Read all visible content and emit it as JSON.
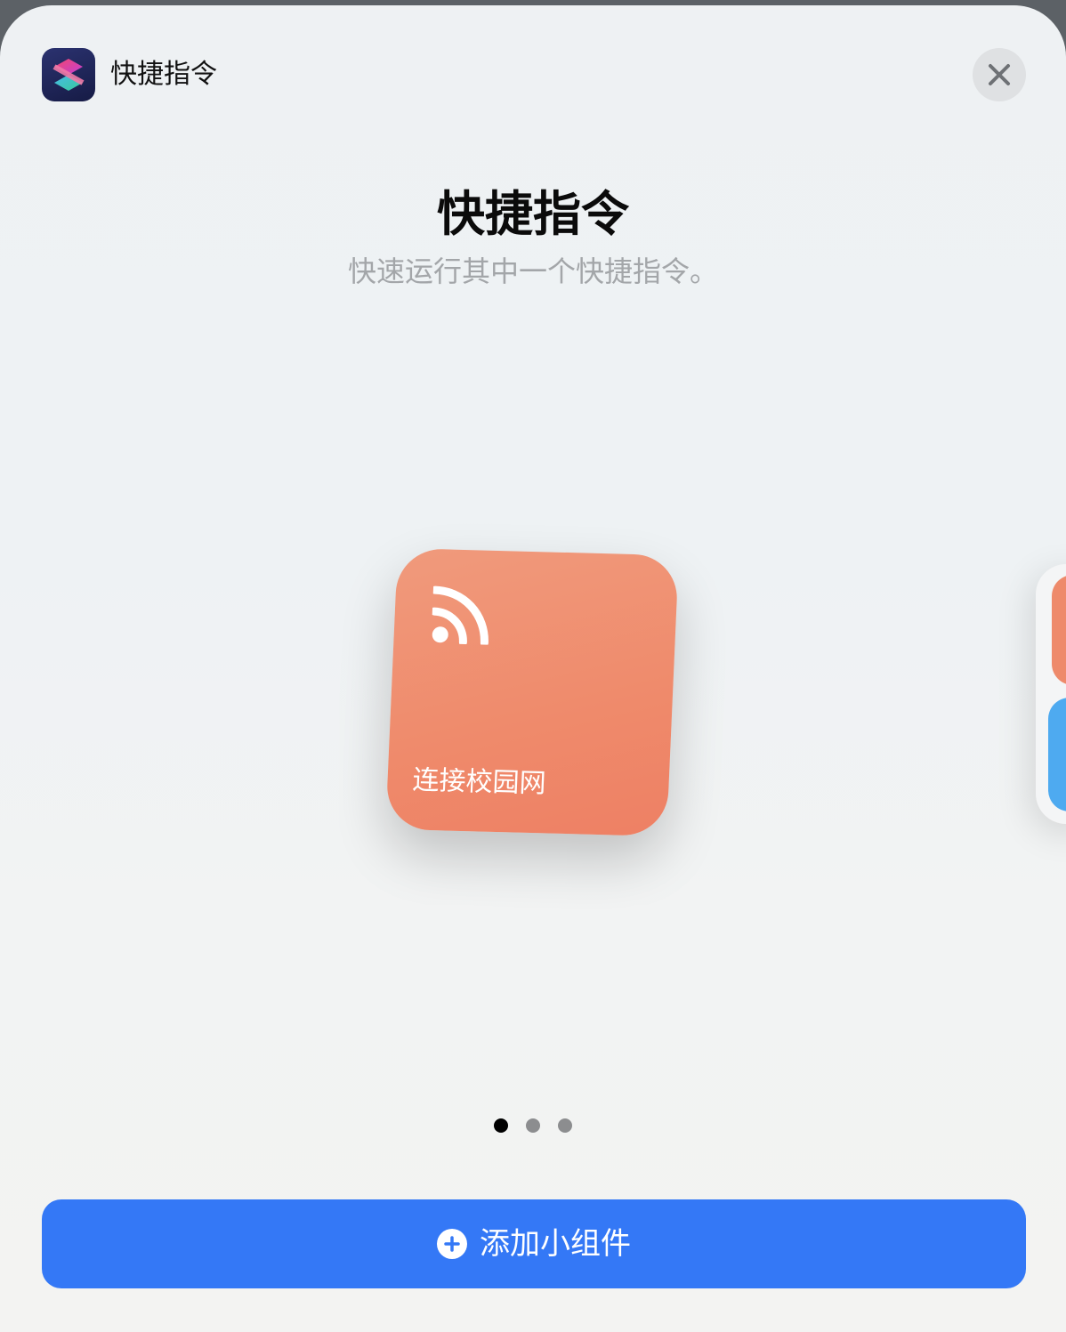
{
  "header": {
    "app_name": "快捷指令",
    "app_icon": "shortcuts-app-icon",
    "close_icon": "close-icon"
  },
  "intro": {
    "title": "快捷指令",
    "subtitle": "快速运行其中一个快捷指令。"
  },
  "widget": {
    "icon": "rss-icon",
    "label": "连接校园网",
    "color": "#ef8c6d"
  },
  "pager": {
    "pages": 3,
    "current": 1
  },
  "add_button": {
    "label": "添加小组件",
    "icon": "plus-circle-icon",
    "color": "#3478f6"
  }
}
